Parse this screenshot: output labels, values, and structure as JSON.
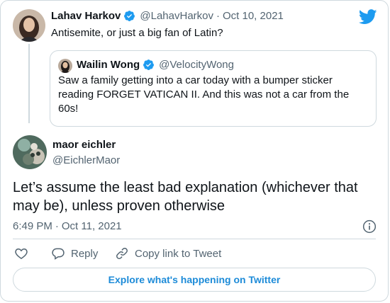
{
  "colors": {
    "accent": "#1d9bf0",
    "border": "#cfd9de",
    "muted": "#536471",
    "text": "#0f1419"
  },
  "parent_tweet": {
    "author_name": "Lahav Harkov",
    "handle": "@LahavHarkov",
    "separator": "·",
    "date": "Oct 10, 2021",
    "text": "Antisemite, or just a big fan of Latin?",
    "verified": true
  },
  "quoted_tweet": {
    "author_name": "Wailin Wong",
    "handle": "@VelocityWong",
    "text": "Saw a family getting into a car today with a bumper sticker reading FORGET VATICAN II. And this was not a car from the 60s!",
    "verified": true
  },
  "main_tweet": {
    "author_name": "maor eichler",
    "handle": "@EichlerMaor",
    "text": "Let’s assume the least bad explanation (whichever that may be), unless proven otherwise",
    "time": "6:49 PM",
    "separator": "·",
    "date": "Oct 11, 2021"
  },
  "actions": {
    "reply_label": "Reply",
    "copy_link_label": "Copy link to Tweet"
  },
  "explore_label": "Explore what's happening on Twitter",
  "icons": [
    "twitter-bird-icon",
    "verified-badge-icon",
    "info-icon",
    "heart-icon",
    "reply-icon",
    "link-icon"
  ]
}
